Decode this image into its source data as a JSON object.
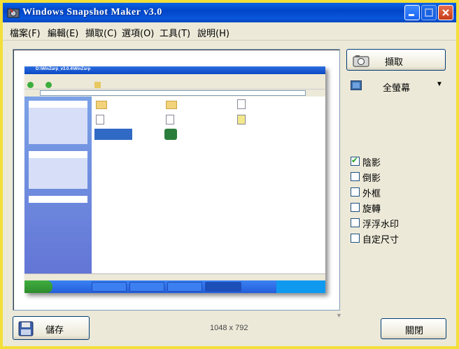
{
  "window": {
    "title": "Windows Snapshot Maker v3.0"
  },
  "menu": [
    {
      "label": "檔案(F)"
    },
    {
      "label": "編輯(E)"
    },
    {
      "label": "擷取(C)"
    },
    {
      "label": "選項(O)"
    },
    {
      "label": "工具(T)"
    },
    {
      "label": "說明(H)"
    }
  ],
  "capture_button": {
    "label": "擷取"
  },
  "capture_mode": {
    "selected": "全螢幕"
  },
  "options": [
    {
      "label": "陰影",
      "checked": true
    },
    {
      "label": "倒影",
      "checked": false
    },
    {
      "label": "外框",
      "checked": false
    },
    {
      "label": "旋轉",
      "checked": false
    },
    {
      "label": "浮浮水印",
      "checked": false
    },
    {
      "label": "自定尺寸",
      "checked": false
    }
  ],
  "save_button": {
    "label": "儲存"
  },
  "close_button": {
    "label": "關閉"
  },
  "image_size": "1048 x 792",
  "preview": {
    "title": "D:\\WinZurp_v3.0.4\\WinZurp",
    "colors": {
      "titlebar": "#0a56dc",
      "accent_checked": "#21a121",
      "window_border": "#f3df3a"
    }
  }
}
